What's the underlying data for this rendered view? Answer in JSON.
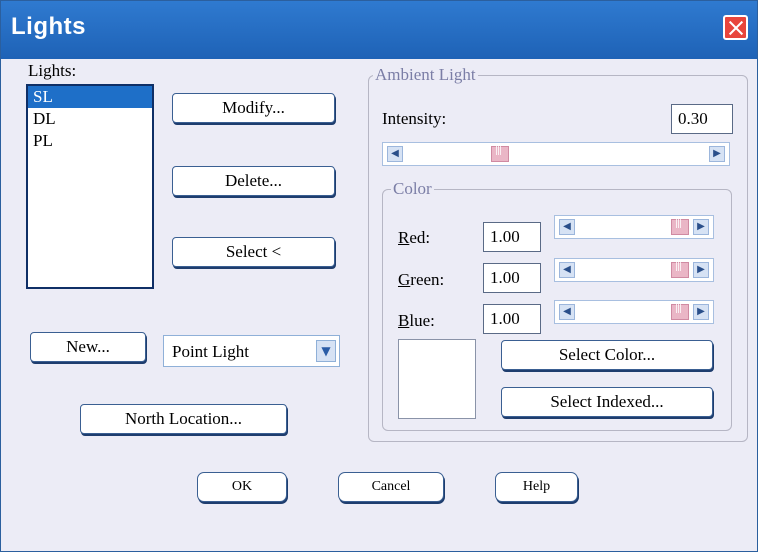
{
  "window": {
    "title": "Lights"
  },
  "lights_list": {
    "label": "Lights:",
    "items": [
      "SL",
      "DL",
      "PL"
    ],
    "selected": "SL"
  },
  "buttons": {
    "modify": "Modify...",
    "delete": "Delete...",
    "select": "Select <",
    "new": "New...",
    "north_location": "North Location...",
    "ok": "OK",
    "cancel": "Cancel",
    "help": "Help",
    "select_color": "Select Color...",
    "select_indexed": "Select Indexed..."
  },
  "light_type": {
    "selected": "Point Light"
  },
  "ambient": {
    "legend": "Ambient Light",
    "intensity_label": "Intensity:",
    "intensity_value": "0.30",
    "intensity_slider_fraction": 0.3,
    "color": {
      "legend": "Color",
      "red_label": "Red:",
      "red_value": "1.00",
      "green_label": "Green:",
      "green_value": "1.00",
      "blue_label": "Blue:",
      "blue_value": "1.00",
      "swatch_color": "#ffffff"
    }
  },
  "icons": {
    "close": "close-icon",
    "dropdown": "chevron-down-icon",
    "scroll_left": "chevron-left-icon",
    "scroll_right": "chevron-right-icon"
  },
  "colors": {
    "titlebar": "#2f7ad0",
    "selection": "#1e6fc8",
    "slider_thumb": "#eab6c6",
    "legend_text": "#7b7ea6"
  }
}
